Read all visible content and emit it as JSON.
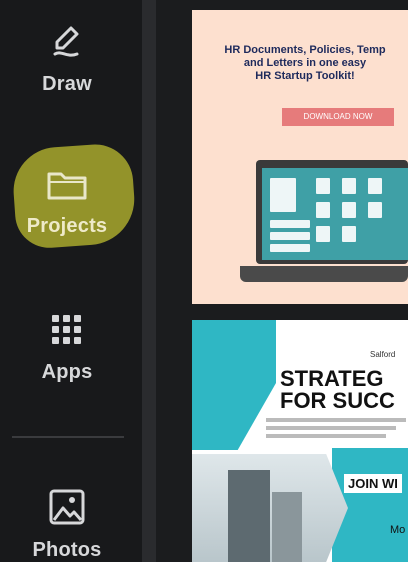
{
  "sidebar": {
    "items": [
      {
        "label": "Draw",
        "icon": "draw-icon"
      },
      {
        "label": "Projects",
        "icon": "folder-icon",
        "highlight_color": "#9a9a2b"
      },
      {
        "label": "Apps",
        "icon": "apps-grid-icon"
      },
      {
        "label": "Photos",
        "icon": "photos-icon"
      }
    ]
  },
  "templates": [
    {
      "headline_line1": "HR Documents, Policies, Temp",
      "headline_line2": "and Letters in one easy",
      "headline_line3": "HR Startup Toolkit!",
      "cta": "DOWNLOAD NOW",
      "bg_color": "#fde0cf"
    },
    {
      "company": "Salford",
      "title_line1": "STRATEG",
      "title_line2": "FOR SUCC",
      "join": "JOIN WI",
      "mo": "Mo",
      "accent_color": "#2fb7c4"
    }
  ]
}
